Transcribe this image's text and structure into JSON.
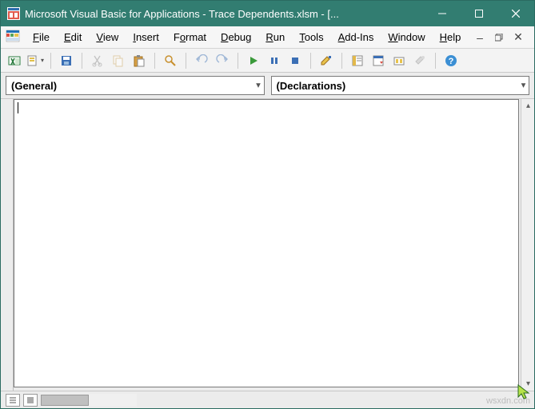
{
  "title": "Microsoft Visual Basic for Applications - Trace Dependents.xlsm - [...",
  "menus": {
    "file": "File",
    "edit": "Edit",
    "view": "View",
    "insert": "Insert",
    "format": "Format",
    "debug": "Debug",
    "run": "Run",
    "tools": "Tools",
    "addins": "Add-Ins",
    "window": "Window",
    "help": "Help"
  },
  "combos": {
    "object": "(General)",
    "procedure": "(Declarations)"
  },
  "watermark": "wsxdn.com"
}
